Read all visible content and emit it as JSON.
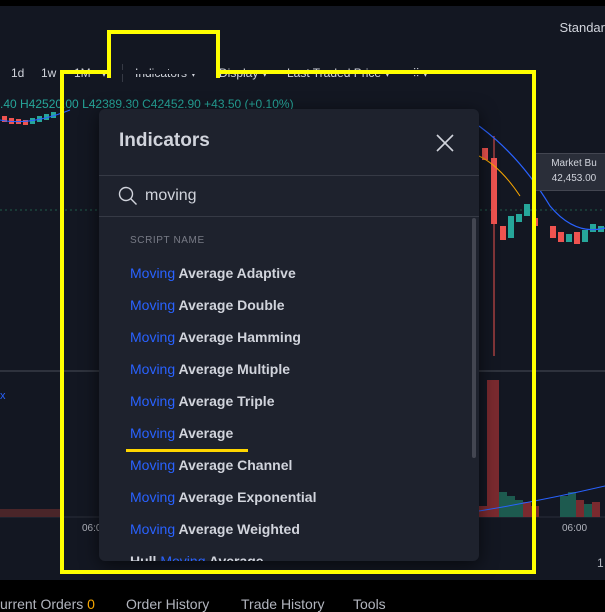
{
  "header": {
    "right_label": "Standar"
  },
  "toolbar": {
    "intervals": [
      "1d",
      "1w",
      "1M"
    ],
    "indicators_label": "Indicators",
    "display_label": "Display",
    "price_label": "Last Traded Price"
  },
  "ohlc_text": ".40 H42520.00 L42389.30 C42452.90 +43.50 (+0.10%)",
  "market_badge": {
    "label": "Market Bu",
    "price": "42,453.00"
  },
  "time_axis": {
    "left": "06:00",
    "right": "06:00",
    "far_right": "1"
  },
  "left_tick": "x",
  "modal": {
    "title": "Indicators",
    "search_value": "moving",
    "section_label": "SCRIPT NAME",
    "results": [
      {
        "pre": "",
        "match": "Moving",
        "post": " Average Adaptive"
      },
      {
        "pre": "",
        "match": "Moving",
        "post": " Average Double"
      },
      {
        "pre": "",
        "match": "Moving",
        "post": " Average Hamming"
      },
      {
        "pre": "",
        "match": "Moving",
        "post": " Average Multiple"
      },
      {
        "pre": "",
        "match": "Moving",
        "post": " Average Triple"
      },
      {
        "pre": "",
        "match": "Moving",
        "post": " Average"
      },
      {
        "pre": "",
        "match": "Moving",
        "post": " Average Channel"
      },
      {
        "pre": "",
        "match": "Moving",
        "post": " Average Exponential"
      },
      {
        "pre": "",
        "match": "Moving",
        "post": " Average Weighted"
      },
      {
        "pre": "Hull ",
        "match": "Moving",
        "post": " Average"
      }
    ]
  },
  "bottom_tabs": [
    {
      "label": "urrent Orders",
      "count": "0"
    },
    {
      "label": "Order History"
    },
    {
      "label": "Trade History"
    },
    {
      "label": "Tools"
    }
  ],
  "colors": {
    "highlight": "#ffff00",
    "match_text": "#2962ff",
    "up_candle": "#26a69a",
    "down_candle": "#ef5350",
    "count_badge": "#f7a600"
  }
}
